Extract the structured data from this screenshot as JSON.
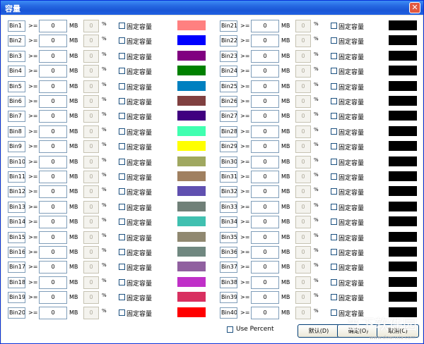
{
  "window": {
    "title": "容量",
    "close_glyph": "✕"
  },
  "labels": {
    "ge": ">=",
    "mb": "MB",
    "percent_sign": "%",
    "fixed": "固定容量"
  },
  "left_bins": [
    {
      "name": "Bin1",
      "value": "0",
      "pct": "0",
      "color": "#ff8080"
    },
    {
      "name": "Bin2",
      "value": "0",
      "pct": "0",
      "color": "#0000ff"
    },
    {
      "name": "Bin3",
      "value": "0",
      "pct": "0",
      "color": "#800080"
    },
    {
      "name": "Bin4",
      "value": "0",
      "pct": "0",
      "color": "#008000"
    },
    {
      "name": "Bin5",
      "value": "0",
      "pct": "0",
      "color": "#0080c0"
    },
    {
      "name": "Bin6",
      "value": "0",
      "pct": "0",
      "color": "#804040"
    },
    {
      "name": "Bin7",
      "value": "0",
      "pct": "0",
      "color": "#400080"
    },
    {
      "name": "Bin8",
      "value": "0",
      "pct": "0",
      "color": "#40ffb0"
    },
    {
      "name": "Bin9",
      "value": "0",
      "pct": "0",
      "color": "#ffff00"
    },
    {
      "name": "Bin10",
      "value": "0",
      "pct": "0",
      "color": "#a0a860"
    },
    {
      "name": "Bin11",
      "value": "0",
      "pct": "0",
      "color": "#a08060"
    },
    {
      "name": "Bin12",
      "value": "0",
      "pct": "0",
      "color": "#6050b0"
    },
    {
      "name": "Bin13",
      "value": "0",
      "pct": "0",
      "color": "#708078"
    },
    {
      "name": "Bin14",
      "value": "0",
      "pct": "0",
      "color": "#40c0b0"
    },
    {
      "name": "Bin15",
      "value": "0",
      "pct": "0",
      "color": "#908870"
    },
    {
      "name": "Bin16",
      "value": "0",
      "pct": "0",
      "color": "#708880"
    },
    {
      "name": "Bin17",
      "value": "0",
      "pct": "0",
      "color": "#9060a0"
    },
    {
      "name": "Bin18",
      "value": "0",
      "pct": "0",
      "color": "#c030c8"
    },
    {
      "name": "Bin19",
      "value": "0",
      "pct": "0",
      "color": "#d83060"
    },
    {
      "name": "Bin20",
      "value": "0",
      "pct": "0",
      "color": "#ff0000"
    }
  ],
  "right_bins": [
    {
      "name": "Bin21",
      "value": "0",
      "pct": "0",
      "color": "#000000"
    },
    {
      "name": "Bin22",
      "value": "0",
      "pct": "0",
      "color": "#000000"
    },
    {
      "name": "Bin23",
      "value": "0",
      "pct": "0",
      "color": "#000000"
    },
    {
      "name": "Bin24",
      "value": "0",
      "pct": "0",
      "color": "#000000"
    },
    {
      "name": "Bin25",
      "value": "0",
      "pct": "0",
      "color": "#000000"
    },
    {
      "name": "Bin26",
      "value": "0",
      "pct": "0",
      "color": "#000000"
    },
    {
      "name": "Bin27",
      "value": "0",
      "pct": "0",
      "color": "#000000"
    },
    {
      "name": "Bin28",
      "value": "0",
      "pct": "0",
      "color": "#000000"
    },
    {
      "name": "Bin29",
      "value": "0",
      "pct": "0",
      "color": "#000000"
    },
    {
      "name": "Bin30",
      "value": "0",
      "pct": "0",
      "color": "#000000"
    },
    {
      "name": "Bin31",
      "value": "0",
      "pct": "0",
      "color": "#000000"
    },
    {
      "name": "Bin32",
      "value": "0",
      "pct": "0",
      "color": "#000000"
    },
    {
      "name": "Bin33",
      "value": "0",
      "pct": "0",
      "color": "#000000"
    },
    {
      "name": "Bin34",
      "value": "0",
      "pct": "0",
      "color": "#000000"
    },
    {
      "name": "Bin35",
      "value": "0",
      "pct": "0",
      "color": "#000000"
    },
    {
      "name": "Bin36",
      "value": "0",
      "pct": "0",
      "color": "#000000"
    },
    {
      "name": "Bin37",
      "value": "0",
      "pct": "0",
      "color": "#000000"
    },
    {
      "name": "Bin38",
      "value": "0",
      "pct": "0",
      "color": "#000000"
    },
    {
      "name": "Bin39",
      "value": "0",
      "pct": "0",
      "color": "#000000"
    },
    {
      "name": "Bin40",
      "value": "0",
      "pct": "0",
      "color": "#000000"
    }
  ],
  "footer": {
    "use_percent": "Use Percent",
    "default_button": "默认(D)",
    "ok_button": "确定(O)",
    "cancel_button": "取消(C)"
  },
  "watermark": {
    "main": "当下软件园",
    "sub": "www.downxia.com"
  }
}
